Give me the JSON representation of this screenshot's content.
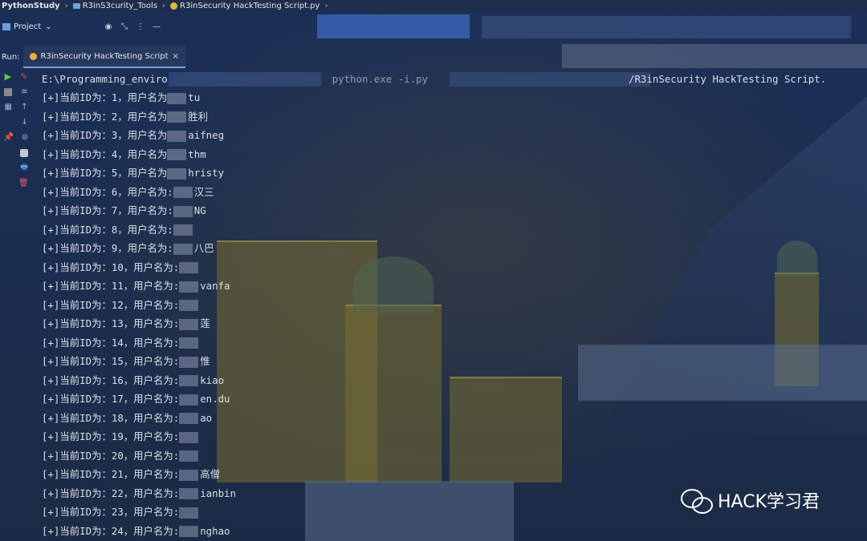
{
  "navbar": {
    "crumbs": [
      "PythonStudy",
      "R3inS3curity_Tools",
      "R3inSecurity HackTesting Script.py"
    ]
  },
  "project": {
    "label": "Project"
  },
  "run": {
    "label": "Run:",
    "tab_label": "R3inSecurity HackTesting Script"
  },
  "console": {
    "command_path_start": "E:\\Programming_enviro",
    "command_path_mid": "python.exe -i.py",
    "command_path_end": "/R3inSecurity HackTesting Script.",
    "lines": [
      {
        "prefix": "[+]当前ID为：1，用户名为",
        "tail": "tu"
      },
      {
        "prefix": "[+]当前ID为：2，用户名为",
        "tail": "胜利"
      },
      {
        "prefix": "[+]当前ID为：3，用户名为",
        "tail": "aifneg"
      },
      {
        "prefix": "[+]当前ID为：4，用户名为",
        "tail": "thm"
      },
      {
        "prefix": "[+]当前ID为：5，用户名为",
        "tail": "hristy"
      },
      {
        "prefix": "[+]当前ID为：6，用户名为:",
        "tail": "汉三"
      },
      {
        "prefix": "[+]当前ID为：7，用户名为:",
        "tail": "NG"
      },
      {
        "prefix": "[+]当前ID为：8，用户名为:",
        "tail": ""
      },
      {
        "prefix": "[+]当前ID为：9，用户名为:",
        "tail": "八巴"
      },
      {
        "prefix": "[+]当前ID为：10，用户名为:",
        "tail": ""
      },
      {
        "prefix": "[+]当前ID为：11，用户名为:",
        "tail": "vanfa"
      },
      {
        "prefix": "[+]当前ID为：12，用户名为:",
        "tail": ""
      },
      {
        "prefix": "[+]当前ID为：13，用户名为:",
        "tail": "莲"
      },
      {
        "prefix": "[+]当前ID为：14，用户名为:",
        "tail": ""
      },
      {
        "prefix": "[+]当前ID为：15，用户名为:",
        "tail": "惟"
      },
      {
        "prefix": "[+]当前ID为：16，用户名为:",
        "tail": "kiao"
      },
      {
        "prefix": "[+]当前ID为：17，用户名为:",
        "tail": "en.du"
      },
      {
        "prefix": "[+]当前ID为：18，用户名为:",
        "tail": "ao"
      },
      {
        "prefix": "[+]当前ID为：19，用户名为:",
        "tail": ""
      },
      {
        "prefix": "[+]当前ID为：20，用户名为:",
        "tail": ""
      },
      {
        "prefix": "[+]当前ID为：21，用户名为:",
        "tail": "高僧"
      },
      {
        "prefix": "[+]当前ID为：22，用户名为:",
        "tail": "ianbin"
      },
      {
        "prefix": "[+]当前ID为：23，用户名为:",
        "tail": ""
      },
      {
        "prefix": "[+]当前ID为：24，用户名为:",
        "tail": "nghao"
      }
    ]
  },
  "watermark": {
    "text": "HACK学习君"
  }
}
